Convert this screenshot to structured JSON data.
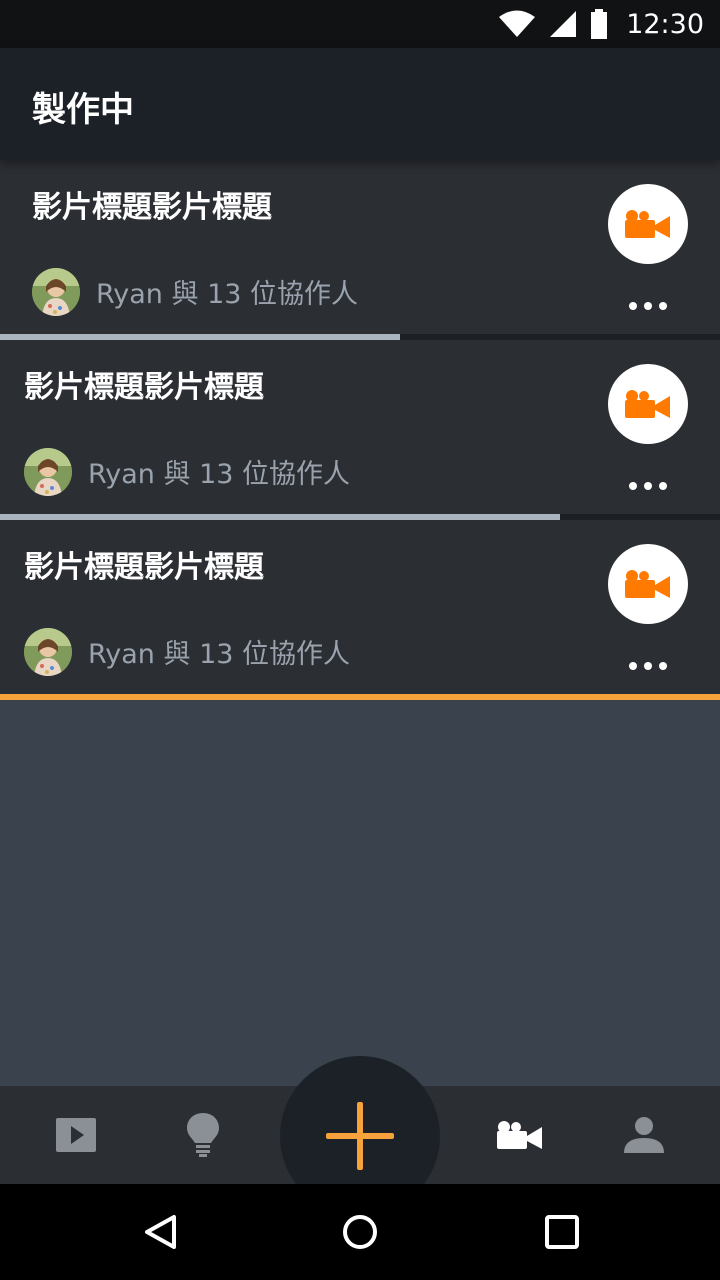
{
  "status_bar": {
    "time": "12:30",
    "icons": [
      "wifi-icon",
      "signal-icon",
      "battery-icon"
    ]
  },
  "header": {
    "title": "製作中"
  },
  "projects": [
    {
      "title": "影片標題影片標題",
      "collaborators": "Ryan 與 13 位協作人",
      "progress": 0.555,
      "progress_color": "#aab4be"
    },
    {
      "title": "影片標題影片標題",
      "collaborators": "Ryan 與 13 位協作人",
      "progress": 0.778,
      "progress_color": "#aab4be"
    },
    {
      "title": "影片標題影片標題",
      "collaborators": "Ryan 與 13 位協作人",
      "progress": 1.0,
      "progress_color": "#f7a23a"
    }
  ],
  "bottom_nav": {
    "items": [
      "play-icon",
      "lightbulb-icon",
      "add-icon",
      "video-camera-icon",
      "person-icon"
    ],
    "active": "video-camera-icon"
  },
  "colors": {
    "accent": "#f7a23a",
    "camera_orange": "#ff7a00",
    "card_bg": "#2b2e33",
    "app_bar_bg": "#1c2128",
    "page_bg": "#3a434d"
  }
}
